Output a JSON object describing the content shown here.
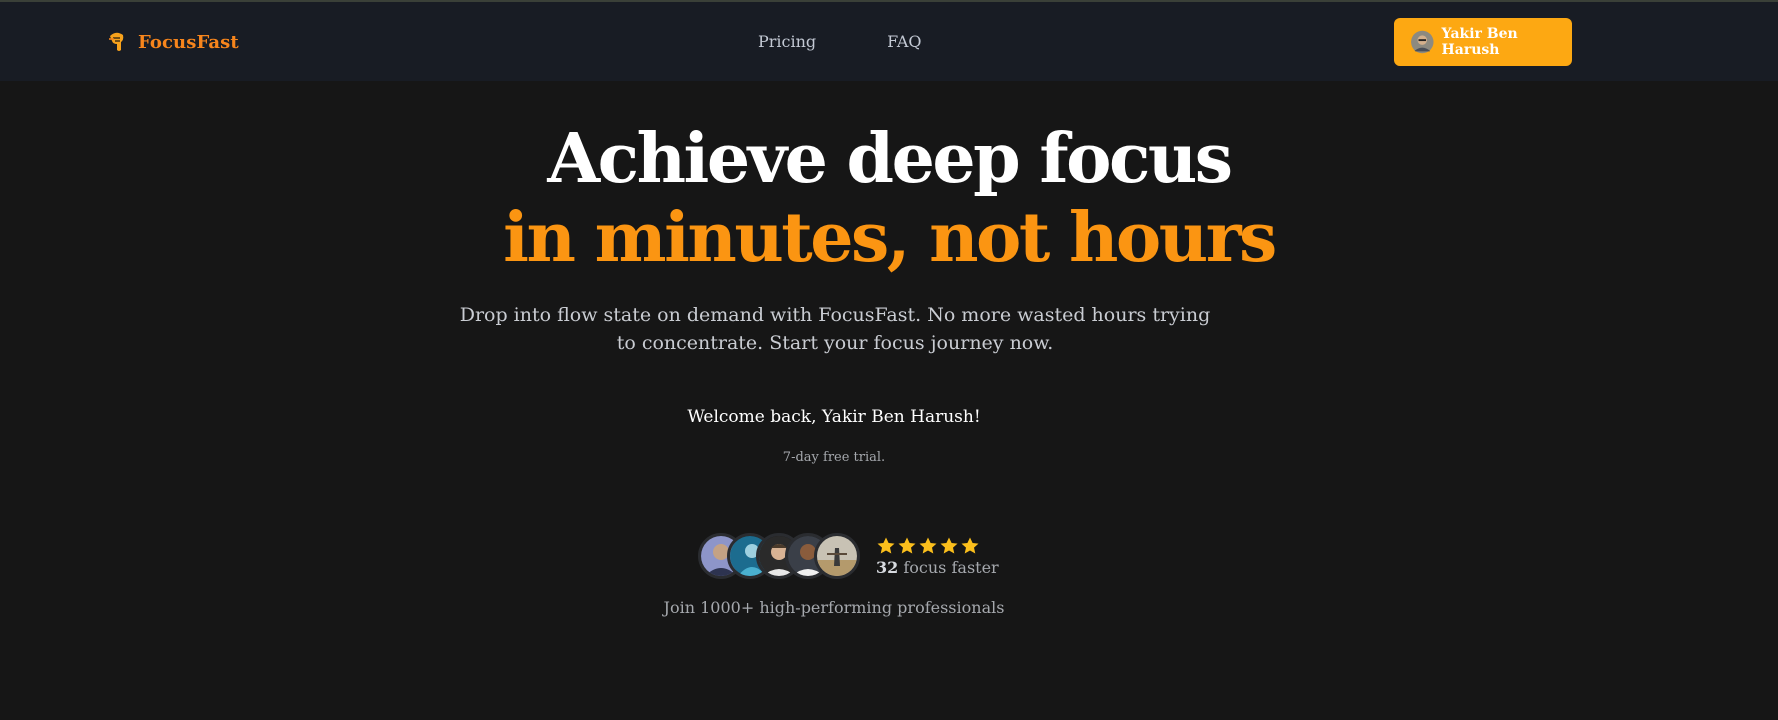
{
  "colors": {
    "accent": "#fb9512",
    "button": "#fda812",
    "background": "#161616",
    "navbar": "#181c24"
  },
  "nav": {
    "brand": "FocusFast",
    "brand_icon": "helmet-logo-icon",
    "links": [
      "Pricing",
      "FAQ"
    ],
    "user_button": "Yakir Ben Harush"
  },
  "hero": {
    "headline_line1": "Achieve deep focus",
    "headline_line2": "in minutes, not hours",
    "subtitle": "Drop into flow state on demand with FocusFast. No more wasted hours trying to concentrate. Start your focus journey now.",
    "welcome": "Welcome back, Yakir Ben Harush!",
    "trial": "7-day free trial."
  },
  "social_proof": {
    "avatar_count": 5,
    "rating_stars": 5,
    "count": "32",
    "count_label": "focus faster",
    "join_text": "Join 1000+ high-performing professionals"
  }
}
